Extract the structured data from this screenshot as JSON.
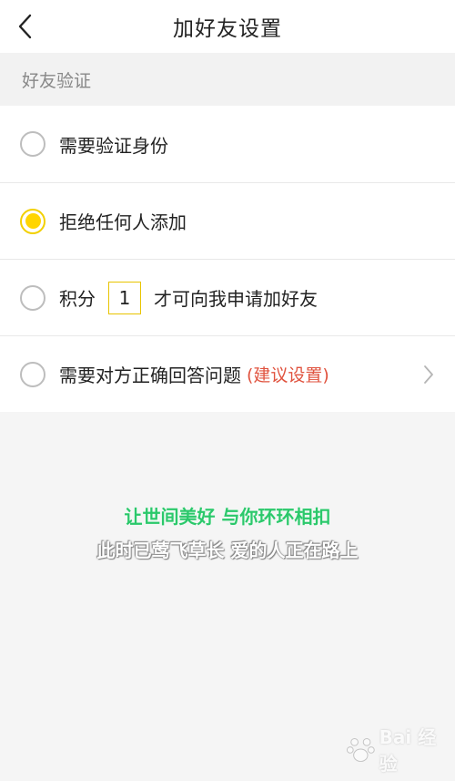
{
  "header": {
    "title": "加好友设置",
    "back_icon": "chevron-left-icon"
  },
  "section": {
    "label": "好友验证"
  },
  "options": [
    {
      "label": "需要验证身份",
      "checked": false
    },
    {
      "label": "拒绝任何人添加",
      "checked": true
    },
    {
      "label_prefix": "积分",
      "points_value": "1",
      "label_suffix": "才可向我申请加好友",
      "checked": false
    },
    {
      "label": "需要对方正确回答问题",
      "suggest": "(建议设置)",
      "checked": false,
      "chevron_icon": "chevron-right-icon"
    }
  ],
  "subtitles": {
    "line1": "让世间美好 与你环环相扣",
    "line2": "此时已莺飞草长 爱的人正在路上"
  },
  "colors": {
    "accent": "#ffd500",
    "suggest": "#e0533f",
    "subtitle_green": "#2bc86b"
  },
  "watermark": {
    "text": "Bai 经验",
    "icon": "baidu-paw-icon"
  }
}
